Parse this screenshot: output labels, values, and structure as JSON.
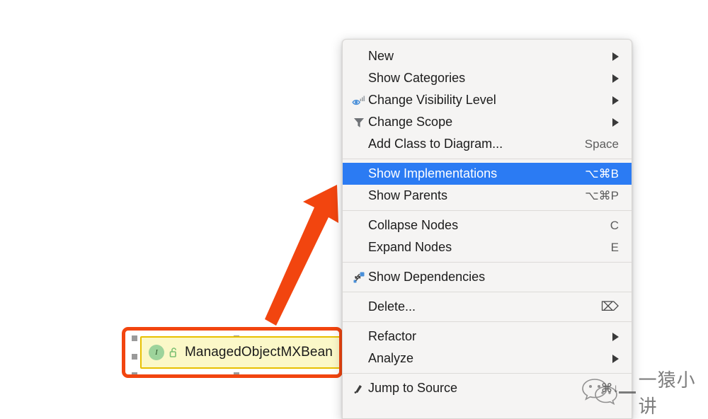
{
  "canvas": {
    "background_color": "#ffffff",
    "class_node": {
      "name": "ManagedObjectMXBean",
      "stereotype_icon": "interface-icon",
      "stereotype_letter": "I",
      "visibility_icon": "unlocked-padlock-icon",
      "node_fill_color": "#fbf8c8",
      "node_border_color": "#e8c000",
      "selected": true,
      "highlight_color": "#f2450f",
      "selection_handle_color": "#9a9a9a"
    },
    "annotation_arrow": {
      "name": "red-arrow-annotation",
      "color": "#f2450f",
      "points_from": "class-node",
      "points_to": "show-implementations-menu-item"
    }
  },
  "context_menu": {
    "background_color": "#f5f4f3",
    "selection_color": "#2b7bf3",
    "groups": [
      {
        "items": [
          {
            "id": "new",
            "label": "New",
            "icon": null,
            "shortcut": null,
            "submenu": true,
            "selected": false
          },
          {
            "id": "show-categories",
            "label": "Show Categories",
            "icon": null,
            "shortcut": null,
            "submenu": true,
            "selected": false
          },
          {
            "id": "change-visibility-level",
            "label": "Change Visibility Level",
            "icon": "eye-visibility-icon",
            "shortcut": null,
            "submenu": true,
            "selected": false
          },
          {
            "id": "change-scope",
            "label": "Change Scope",
            "icon": "funnel-filter-icon",
            "shortcut": null,
            "submenu": true,
            "selected": false
          },
          {
            "id": "add-class-to-diagram",
            "label": "Add Class to Diagram...",
            "icon": null,
            "shortcut": "Space",
            "submenu": false,
            "selected": false
          }
        ]
      },
      {
        "items": [
          {
            "id": "show-implementations",
            "label": "Show Implementations",
            "icon": null,
            "shortcut": "⌥⌘B",
            "submenu": false,
            "selected": true
          },
          {
            "id": "show-parents",
            "label": "Show Parents",
            "icon": null,
            "shortcut": "⌥⌘P",
            "submenu": false,
            "selected": false
          }
        ]
      },
      {
        "items": [
          {
            "id": "collapse-nodes",
            "label": "Collapse Nodes",
            "icon": null,
            "shortcut": "C",
            "submenu": false,
            "selected": false
          },
          {
            "id": "expand-nodes",
            "label": "Expand Nodes",
            "icon": null,
            "shortcut": "E",
            "submenu": false,
            "selected": false
          }
        ]
      },
      {
        "items": [
          {
            "id": "show-dependencies",
            "label": "Show Dependencies",
            "icon": "dependencies-diagram-icon",
            "shortcut": null,
            "submenu": false,
            "selected": false
          }
        ]
      },
      {
        "items": [
          {
            "id": "delete",
            "label": "Delete...",
            "icon": null,
            "shortcut": "⌦",
            "submenu": false,
            "selected": false
          }
        ]
      },
      {
        "items": [
          {
            "id": "refactor",
            "label": "Refactor",
            "icon": null,
            "shortcut": null,
            "submenu": true,
            "selected": false
          },
          {
            "id": "analyze",
            "label": "Analyze",
            "icon": null,
            "shortcut": null,
            "submenu": true,
            "selected": false
          }
        ]
      },
      {
        "items": [
          {
            "id": "jump-to-source",
            "label": "Jump to Source",
            "icon": "jump-to-source-icon",
            "shortcut": "⌘↓",
            "submenu": false,
            "selected": false
          }
        ]
      }
    ]
  },
  "watermark": {
    "text": "一猿小讲",
    "logo_icon": "wechat-logo-icon"
  }
}
